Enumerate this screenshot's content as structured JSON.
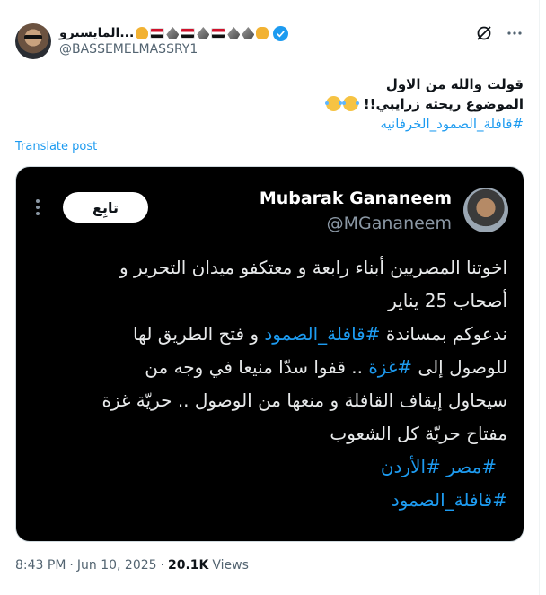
{
  "author": {
    "display_name": "...المايسترو",
    "handle": "@BASSEMELMASSRY1",
    "verified": true,
    "emoji_icons": [
      "fist-emoji-icon",
      "egypt-flag-icon",
      "eagle-emoji-icon",
      "egypt-flag-icon",
      "eagle-emoji-icon",
      "egypt-flag-icon",
      "eagle-emoji-icon",
      "eagle-emoji-icon",
      "flexed-arm-emoji-icon"
    ]
  },
  "header_icons": [
    "grok-icon",
    "more-icon"
  ],
  "tweet": {
    "line1": "قولت والله من الاول",
    "line2": "الموضوع ريحته زرايبي!!",
    "hashtag": "#قافلة_الصمود_الخرفانيه",
    "translate_label": "Translate post"
  },
  "quoted_image": {
    "name": "Mubarak Gananeem",
    "handle": "@MGananeem",
    "follow_label": "تابِع",
    "lines": [
      {
        "text": "اخوتنا المصريين أبناء رابعة و معتكفو ميدان التحرير و"
      },
      {
        "text": "أصحاب 25 يناير"
      },
      {
        "pre": "ندعوكم بمساندة ",
        "tag": "#قافلة_الصمود",
        "post": " و فتح الطريق لها"
      },
      {
        "pre": "للوصول إلى ",
        "tag": "#غزة",
        "post": " .. قفوا سدّا منيعا في وجه من"
      },
      {
        "text": "سيحاول إيقاف القافلة و منعها من الوصول .. حريّة غزة"
      },
      {
        "text": "مفتاح حريّة  كل الشعوب"
      },
      {
        "tag": "#مصر #الأردن"
      },
      {
        "tag": "#قافلة_الصمود"
      }
    ]
  },
  "meta": {
    "time": "8:43 PM",
    "date": "Jun 10, 2025",
    "views_count": "20.1K",
    "views_label": "Views",
    "separator": "·"
  },
  "colors": {
    "accent": "#1d9bf0",
    "text": "#0f1419",
    "muted": "#536471"
  }
}
